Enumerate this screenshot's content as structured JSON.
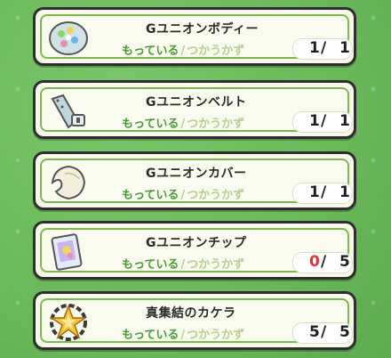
{
  "labels": {
    "have": "もっている",
    "slash": "/",
    "use": "つかうかず"
  },
  "items": [
    {
      "name": "Gユニオンボディー",
      "have": "1",
      "use": "1",
      "icon": "armor-body-icon"
    },
    {
      "name": "Gユニオンベルト",
      "have": "1",
      "use": "1",
      "icon": "belt-icon"
    },
    {
      "name": "Gユニオンカバー",
      "have": "1",
      "use": "1",
      "icon": "cover-icon"
    },
    {
      "name": "Gユニオンチップ",
      "have": "0",
      "use": "5",
      "icon": "chip-card-icon"
    },
    {
      "name": "真集結のカケラ",
      "have": "5",
      "use": "5",
      "icon": "star-fragment-icon"
    }
  ],
  "colors": {
    "background": "#69b85a",
    "accent_green": "#4a9a3a",
    "insufficient": "#e23131"
  }
}
